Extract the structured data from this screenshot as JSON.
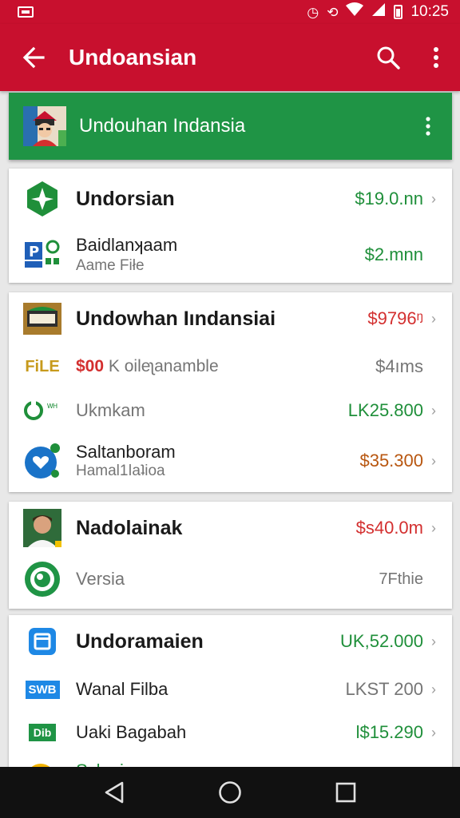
{
  "status_bar": {
    "time": "10:25",
    "icons": [
      "notification-icon",
      "alarm-icon",
      "sync-icon",
      "wifi-icon",
      "signal-icon",
      "battery-icon"
    ]
  },
  "app_bar": {
    "title": "Undoansian",
    "back_icon": "arrow-back-icon",
    "search_icon": "search-icon",
    "more_icon": "more-vert-icon",
    "color": "#c8102e"
  },
  "banner": {
    "title": "Undouhan Indansia",
    "avatar_icon": "avatar-icon",
    "more_icon": "more-vert-icon",
    "color": "#1f9445"
  },
  "cards": [
    {
      "rows": [
        {
          "icon": "compass-star-icon",
          "title": "Undorsian",
          "amount": "$19.0.nn"
        },
        {
          "icon": "parking-badge-icon",
          "title": "Baidlanʞaam",
          "subtitle": "Aame Fiłe",
          "amount": "$2.mnn"
        }
      ]
    },
    {
      "rows": [
        {
          "icon": "money-box-icon",
          "title": "Undowhan Iındansiai",
          "amount": "$9796ᵑ"
        },
        {
          "icon": "file-label-icon",
          "icon_text": "FiLE",
          "prefix": "$00",
          "title": "K oileʅanamble",
          "amount": "$4ıms"
        },
        {
          "icon": "refresh-badge-icon",
          "icon_text": "ᵂᴴ",
          "title": "Ukmkam",
          "amount": "LK25.800"
        },
        {
          "icon": "heart-circle-icon",
          "title": "Saltanboram",
          "subtitle": "Hamal1ǀaʇioa",
          "amount": "$35.300"
        }
      ]
    },
    {
      "rows": [
        {
          "icon": "person-avatar-icon",
          "title": "Nadolainak",
          "amount": "$s40.0m"
        },
        {
          "icon": "green-ring-icon",
          "title": "Versia",
          "amount": "7Fthie"
        }
      ]
    },
    {
      "rows": [
        {
          "icon": "blue-window-icon",
          "title": "Undoramaien",
          "amount": "UK,52.000"
        },
        {
          "icon": "swb-badge-icon",
          "icon_text": "SWB",
          "title": "Wanal Filba",
          "amount": "LKST 200"
        },
        {
          "icon": "dib-badge-icon",
          "icon_text": "Dib",
          "title": "Uaki Bagabah",
          "amount": "l$15.290"
        },
        {
          "icon": "yellow-circle-icon",
          "title": "Sslupi"
        }
      ]
    }
  ],
  "nav_bar": {
    "back_icon": "nav-back-icon",
    "home_icon": "nav-home-icon",
    "recents_icon": "nav-recents-icon"
  }
}
